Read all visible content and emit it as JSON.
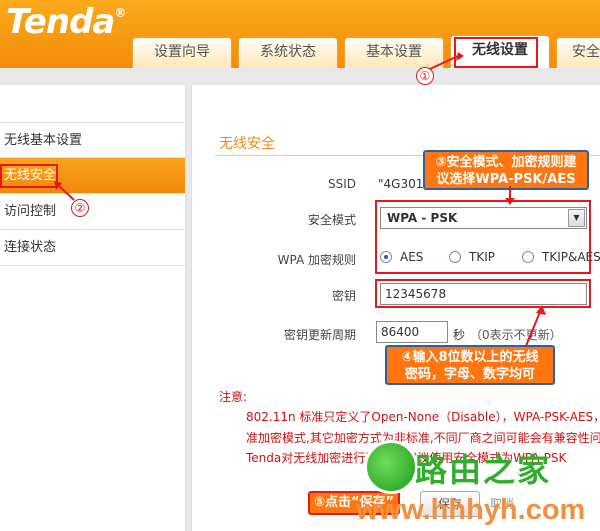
{
  "header": {
    "logo": "Tenda",
    "logo_mark": "®",
    "tabs": [
      {
        "label": "设置向导"
      },
      {
        "label": "系统状态"
      },
      {
        "label": "基本设置"
      },
      {
        "label": "无线设置"
      },
      {
        "label": "安全"
      }
    ]
  },
  "sidebar": {
    "items": [
      {
        "label": "无线基本设置"
      },
      {
        "label": "无线安全"
      },
      {
        "label": "访问控制"
      },
      {
        "label": "连接状态"
      }
    ]
  },
  "main": {
    "title": "无线安全",
    "ssid_label": "SSID",
    "ssid_value": "\"4G301\"",
    "mode_label": "安全模式",
    "mode_value": "WPA - PSK",
    "wpa_rule_label": "WPA 加密规则",
    "wpa_options": [
      "AES",
      "TKIP",
      "TKIP&AES"
    ],
    "wpa_selected": "AES",
    "key_label": "密钥",
    "key_value": "12345678",
    "renew_label": "密钥更新周期",
    "renew_value": "86400",
    "renew_unit": "秒",
    "renew_hint": "（0表示不更新）"
  },
  "notice": {
    "title": "注意:",
    "line1": "802.11n 标准只定义了Open-None（Disable），WPA-PSK-AES，W",
    "line2": "准加密模式,其它加密方式为非标准,不同厂商之间可能会有兼容性问题",
    "line3": "Tenda对无线加密进行了优化,建议使用安全模式为WPA-PSK"
  },
  "buttons": {
    "save": "保存",
    "cancel": "取消"
  },
  "annotations": {
    "step1": "①",
    "step2": "②",
    "step3": "③安全模式、加密规则建议选择WPA-PSK/AES",
    "step3_line1": "③安全模式、加密规则建",
    "step3_line2": "议选择WPA-PSK/AES",
    "step4_line1": "④输入8位数以上的无线",
    "step4_line2": "密码，字母、数字均可",
    "step5": "⑤点击“保存”"
  },
  "watermark": {
    "name": "路由之家",
    "url": "www.hhhyh.com"
  },
  "colors": {
    "accent": "#f58c0a",
    "highlight": "#e8171c",
    "callout": "#ff7611",
    "watermark_green": "#2fae2a"
  }
}
